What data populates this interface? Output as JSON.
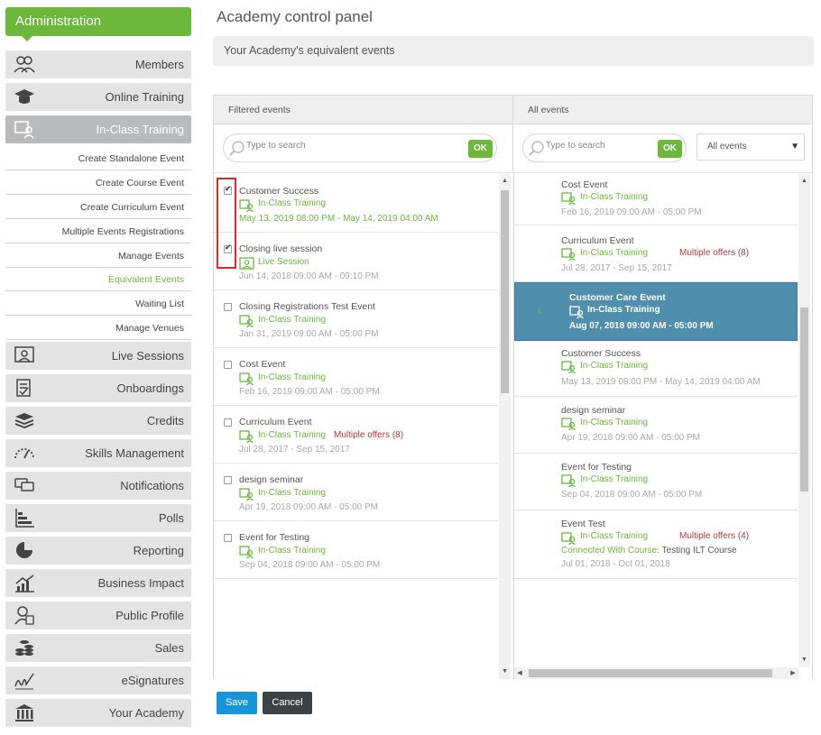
{
  "sidebar": {
    "header": "Administration",
    "items": [
      {
        "label": "Members",
        "icon": "members-icon"
      },
      {
        "label": "Online Training",
        "icon": "graduation-cap-icon"
      },
      {
        "label": "In-Class Training",
        "icon": "classroom-icon",
        "active": true
      },
      {
        "label": "Live Sessions",
        "icon": "live-session-icon"
      },
      {
        "label": "Onboardings",
        "icon": "onboarding-icon"
      },
      {
        "label": "Credits",
        "icon": "credits-stack-icon"
      },
      {
        "label": "Skills Management",
        "icon": "gauge-icon"
      },
      {
        "label": "Notifications",
        "icon": "chat-bubbles-icon"
      },
      {
        "label": "Polls",
        "icon": "bar-chart-icon"
      },
      {
        "label": "Reporting",
        "icon": "pie-chart-icon"
      },
      {
        "label": "Business Impact",
        "icon": "trend-chart-icon"
      },
      {
        "label": "Public Profile",
        "icon": "profile-icon"
      },
      {
        "label": "Sales",
        "icon": "coins-icon"
      },
      {
        "label": "eSignatures",
        "icon": "signature-icon"
      },
      {
        "label": "Your Academy",
        "icon": "academy-building-icon"
      }
    ],
    "subitems": [
      {
        "label": "Create Standalone Event"
      },
      {
        "label": "Create Course Event"
      },
      {
        "label": "Create Curriculum Event"
      },
      {
        "label": "Multiple Events Registrations"
      },
      {
        "label": "Manage Events"
      },
      {
        "label": "Equivalent Events",
        "current": true
      },
      {
        "label": "Waiting List"
      },
      {
        "label": "Manage Venues"
      }
    ]
  },
  "main": {
    "title": "Academy control panel",
    "subheader": "Your Academy's equivalent events",
    "filtered": {
      "header": "Filtered events",
      "search_placeholder": "Type to search",
      "ok_label": "OK",
      "events": [
        {
          "title": "Customer Success",
          "type": "In-Class Training",
          "date": "May 13, 2019 08:00 PM - May 14, 2019 04:00 AM",
          "checked": true,
          "date_green": true
        },
        {
          "title": "Closing  live session",
          "type": "Live Session",
          "date": "Jun 14, 2018 09:00 AM - 09:10 PM",
          "checked": true
        },
        {
          "title": "Closing Registrations Test Event",
          "type": "In-Class Training",
          "date": "Jan 31, 2019 09:00 AM - 05:00 PM"
        },
        {
          "title": "Cost Event",
          "type": "In-Class Training",
          "date": "Feb 16, 2019 09:00 AM - 05:00 PM"
        },
        {
          "title": "Curriculum Event",
          "type": "In-Class Training",
          "offers": "Multiple offers (8)",
          "date": "Jul 28, 2017 - Sep 15, 2017"
        },
        {
          "title": "design seminar",
          "type": "In-Class Training",
          "date": "Apr 19, 2018 09:00 AM - 05:00 PM"
        },
        {
          "title": "Event for Testing",
          "type": "In-Class Training",
          "date": "Sep 04, 2018 09:00 AM - 05:00 PM"
        }
      ]
    },
    "all": {
      "header": "All events",
      "search_placeholder": "Type to search",
      "ok_label": "OK",
      "dropdown_value": "All events",
      "events": [
        {
          "title": "Cost Event",
          "type": "In-Class Training",
          "date": "Feb 16, 2019 09:00 AM - 05:00 PM"
        },
        {
          "title": "Curriculum Event",
          "type": "In-Class Training",
          "offers": "Multiple offers (8)",
          "date": "Jul 28, 2017 - Sep 15, 2017"
        },
        {
          "title": "Customer Care Event",
          "type": "In-Class Training",
          "date": "Aug 07, 2018 09:00 AM - 05:00 PM",
          "selected": true
        },
        {
          "title": "Customer Success",
          "type": "In-Class Training",
          "date": "May 13, 2019 08:00 PM - May 14, 2019 04:00 AM"
        },
        {
          "title": "design seminar",
          "type": "In-Class Training",
          "date": "Apr 19, 2018 09:00 AM - 05:00 PM"
        },
        {
          "title": "Event for Testing",
          "type": "In-Class Training",
          "date": "Sep 04, 2018 09:00 AM - 05:00 PM"
        },
        {
          "title": "Event Test",
          "type": "In-Class Training",
          "offers": "Multiple offers (4)",
          "connected_label": "Connected With Course:",
          "connected_course": "Testing ILT Course",
          "date": "Jul 01, 2018 - Oct 01, 2018"
        }
      ]
    },
    "save_label": "Save",
    "cancel_label": "Cancel"
  },
  "colors": {
    "accent_green": "#6bb83d",
    "selected_blue": "#4f8fad",
    "save_blue": "#1a94d8",
    "offers_red": "#b23a3a",
    "highlight_red": "#d92b2b"
  }
}
